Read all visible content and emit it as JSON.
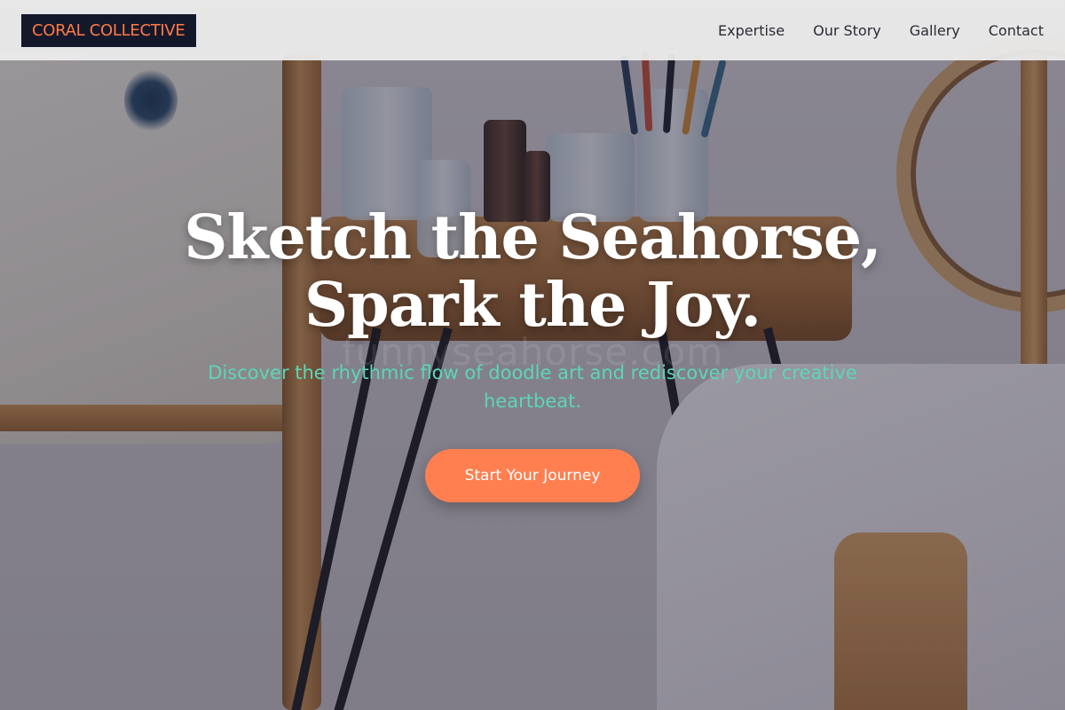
{
  "brand": {
    "name": "CORAL COLLECTIVE",
    "accent": "#ff7f50",
    "logo_bg": "#14182b"
  },
  "nav": {
    "items": [
      {
        "label": "Expertise"
      },
      {
        "label": "Our Story"
      },
      {
        "label": "Gallery"
      },
      {
        "label": "Contact"
      }
    ]
  },
  "hero": {
    "headline_line1": "Sketch the Seahorse,",
    "headline_line2": "Spark the Joy.",
    "subheadline": "Discover the rhythmic flow of doodle art and rediscover your creative heartbeat.",
    "subheadline_color": "#5cd6b8",
    "cta_label": "Start Your Journey",
    "background_watermark": "funnyseahorse.com"
  }
}
